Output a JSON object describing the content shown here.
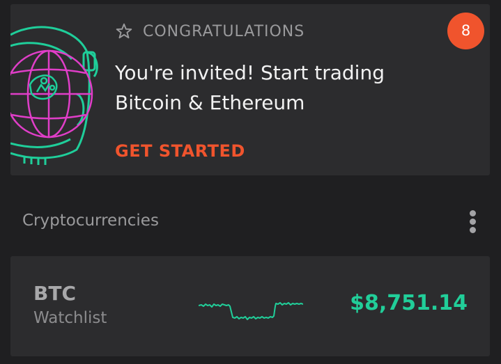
{
  "colors": {
    "background": "#1f1f21",
    "card": "#2c2c2e",
    "accent_orange": "#f0542d",
    "accent_green": "#21ce99",
    "illustration_pink": "#e03ec8",
    "illustration_green": "#1fce9a"
  },
  "promo": {
    "badge_count": "8",
    "eyebrow_icon": "star-outline-icon",
    "eyebrow": "CONGRATULATIONS",
    "headline": "You're invited! Start trading Bitcoin & Ethereum",
    "cta_label": "GET STARTED",
    "illustration_icon": "astronaut-globe-illustration"
  },
  "section": {
    "title": "Cryptocurrencies",
    "menu_icon": "more-vertical-icon"
  },
  "asset": {
    "ticker": "BTC",
    "subtitle": "Watchlist",
    "price": "$8,751.14",
    "sparkline_color": "#21ce99"
  }
}
